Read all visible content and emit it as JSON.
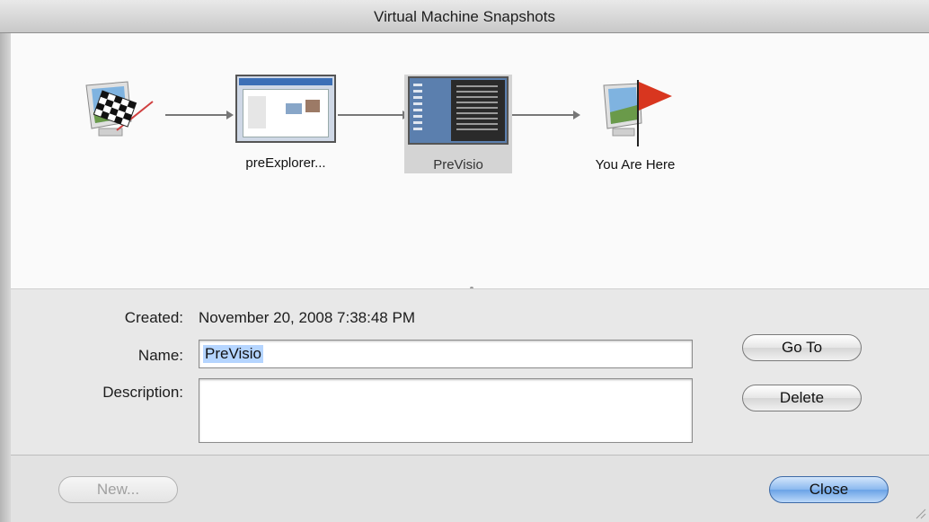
{
  "window": {
    "title": "Virtual Machine Snapshots"
  },
  "snapshots": [
    {
      "label": "",
      "icon": "start-flag-icon"
    },
    {
      "label": "preExplorer...",
      "icon": "snapshot-thumbnail"
    },
    {
      "label": "PreVisio",
      "icon": "snapshot-thumbnail",
      "selected": true
    },
    {
      "label": "You Are Here",
      "icon": "current-state-flag-icon"
    }
  ],
  "details": {
    "created_label": "Created:",
    "created_value": "November 20, 2008 7:38:48 PM",
    "name_label": "Name:",
    "name_value": "PreVisio",
    "description_label": "Description:",
    "description_value": ""
  },
  "buttons": {
    "goto": "Go To",
    "delete": "Delete",
    "new": "New...",
    "close": "Close"
  },
  "colors": {
    "accent": "#6aa2e6",
    "selection": "#b5d5ff"
  }
}
